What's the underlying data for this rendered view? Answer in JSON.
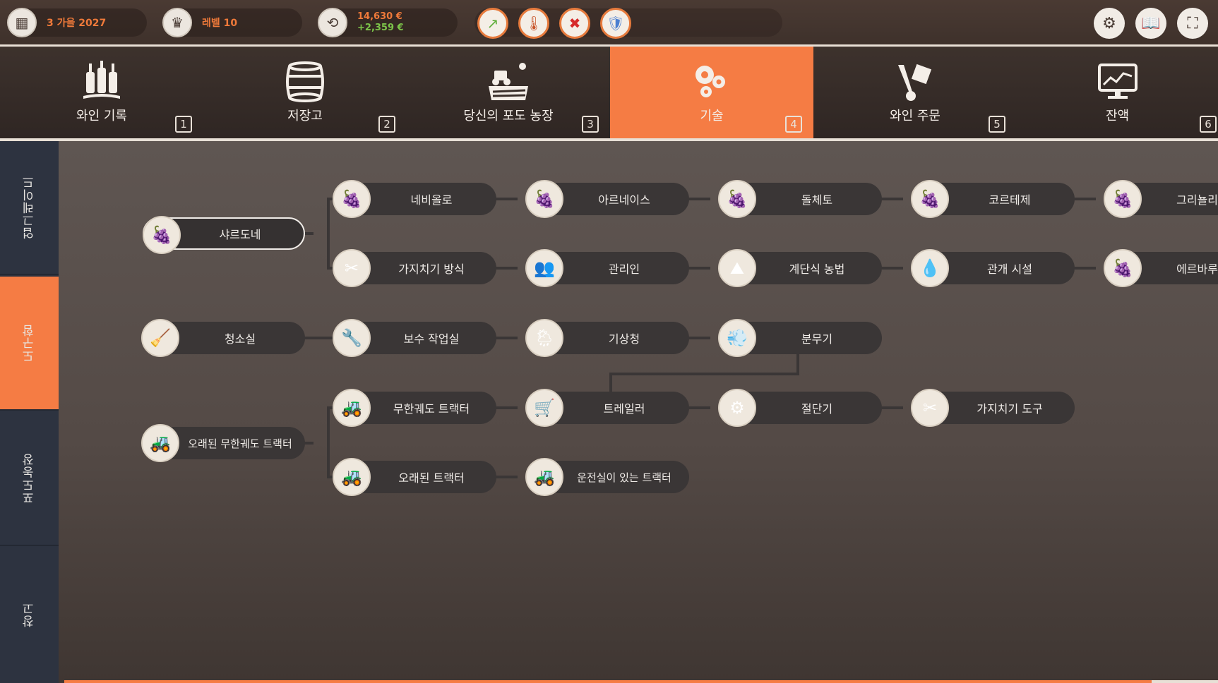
{
  "topbar": {
    "date": "3 가을 2027",
    "level": "레벨 10",
    "money_total": "14,630 €",
    "money_delta": "+2,359 €",
    "alerts": [
      {
        "icon": "trend-up-icon",
        "glyph": "↗"
      },
      {
        "icon": "thermometer-icon",
        "glyph": "🌡"
      },
      {
        "icon": "cancel-worker-icon",
        "glyph": "✖"
      },
      {
        "icon": "shield-icon",
        "glyph": "🛡"
      }
    ],
    "system": [
      {
        "icon": "gear-icon",
        "glyph": "⚙"
      },
      {
        "icon": "book-icon",
        "glyph": "📖"
      },
      {
        "icon": "fullscreen-icon",
        "glyph": "⛶"
      }
    ]
  },
  "tabs": [
    {
      "label": "와인 기록",
      "key": "1",
      "icon": "wine-bottles-icon"
    },
    {
      "label": "저장고",
      "key": "2",
      "icon": "barrel-icon"
    },
    {
      "label": "당신의 포도 농장",
      "key": "3",
      "icon": "vineyard-icon"
    },
    {
      "label": "기술",
      "key": "4",
      "icon": "gears-icon",
      "active": true
    },
    {
      "label": "와인 주문",
      "key": "5",
      "icon": "hand-truck-icon"
    },
    {
      "label": "잔액",
      "key": "6",
      "icon": "monitor-chart-icon"
    }
  ],
  "sidebar": [
    {
      "label": "업그레이드"
    },
    {
      "label": "도구함",
      "active": true
    },
    {
      "label": "포도농장"
    },
    {
      "label": "창고"
    }
  ],
  "nodes": {
    "chardonnay": {
      "label": "샤르도네",
      "glyph": "🍇"
    },
    "nebbiolo": {
      "label": "네비올로",
      "glyph": "🍇"
    },
    "arneis": {
      "label": "아르네이스",
      "glyph": "🍇"
    },
    "dolcetto": {
      "label": "돌체토",
      "glyph": "🍇"
    },
    "cortese": {
      "label": "코르테제",
      "glyph": "🍇"
    },
    "grignolino": {
      "label": "그리뇰리",
      "glyph": "🍇"
    },
    "pruning_method": {
      "label": "가지치기 방식",
      "glyph": "✂"
    },
    "manager": {
      "label": "관리인",
      "glyph": "👥"
    },
    "terrace": {
      "label": "계단식 농법",
      "glyph": "⛰"
    },
    "irrigation": {
      "label": "관개 시설",
      "glyph": "💧"
    },
    "erbaluce": {
      "label": "에르바루",
      "glyph": "🍇"
    },
    "cleaning_room": {
      "label": "청소실",
      "glyph": "🧹"
    },
    "repair_shop": {
      "label": "보수 작업실",
      "glyph": "🔧"
    },
    "weather_station": {
      "label": "기상청",
      "glyph": "🌦"
    },
    "sprayer": {
      "label": "분무기",
      "glyph": "💨"
    },
    "old_crawler_tractor": {
      "label": "오래된 무한궤도 트랙터",
      "glyph": "🚜"
    },
    "crawler_tractor": {
      "label": "무한궤도 트랙터",
      "glyph": "🚜"
    },
    "trailer": {
      "label": "트레일러",
      "glyph": "🛒"
    },
    "cutter": {
      "label": "절단기",
      "glyph": "⚙"
    },
    "pruning_tool": {
      "label": "가지치기 도구",
      "glyph": "✂"
    },
    "old_tractor": {
      "label": "오래된 트랙터",
      "glyph": "🚜"
    },
    "cab_tractor": {
      "label": "운전실이 있는 트랙터",
      "glyph": "🚜"
    }
  }
}
